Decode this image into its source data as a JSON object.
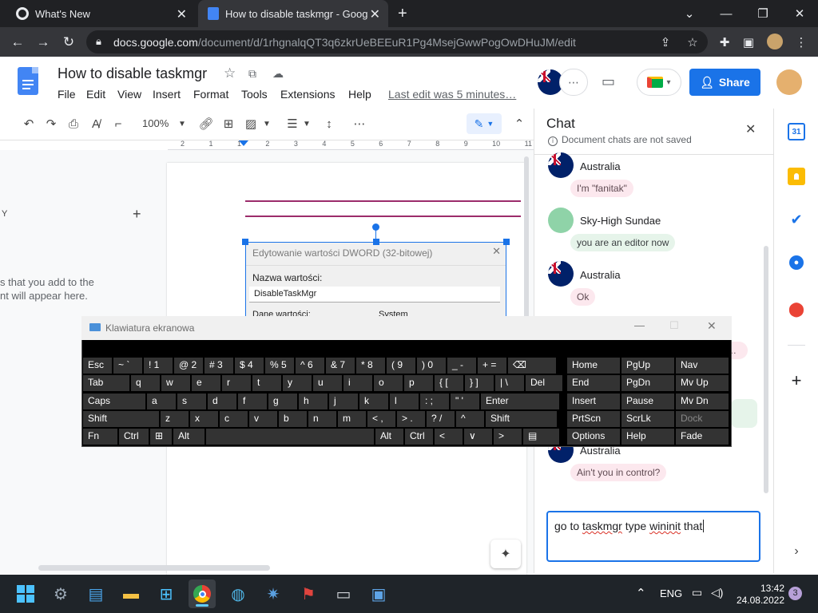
{
  "browser": {
    "tabs": [
      {
        "title": "What's New"
      },
      {
        "title": "How to disable taskmgr - Google Docs"
      }
    ],
    "url_host": "docs.google.com",
    "url_path": "/document/d/1rhgnalqQT3q6zkrUeBEEuR1Pg4MsejGwwPogOwDHuJM/edit"
  },
  "docs": {
    "title": "How to disable taskmgr",
    "menu": [
      "File",
      "Edit",
      "View",
      "Insert",
      "Format",
      "Tools",
      "Extensions",
      "Help"
    ],
    "last_edit": "Last edit was 5 minutes…",
    "share_label": "Share",
    "zoom": "100%",
    "outline_hint_1": "s that you add to the",
    "outline_hint_2": "nt will appear here.",
    "outline_letter": "Y",
    "ruler_marks": [
      "2",
      "1",
      "1",
      "2",
      "3",
      "4",
      "5",
      "6",
      "7",
      "8",
      "9",
      "10",
      "11"
    ]
  },
  "embedded_dialog": {
    "title": "Edytowanie wartości DWORD (32-bitowej)",
    "name_label": "Nazwa wartości:",
    "name_value": "DisableTaskMgr",
    "data_label": "Dane wartości:",
    "base_label": "System"
  },
  "chat": {
    "title": "Chat",
    "subtitle": "Document chats are not saved",
    "messages": [
      {
        "sender": "Australia",
        "text": "I'm \"fanitak\""
      },
      {
        "sender": "Sky-High Sundae",
        "text": "you are an editor now"
      },
      {
        "sender": "Australia",
        "text": "Ok"
      },
      {
        "sender": "Australia",
        "text": "Ain't you in control?"
      }
    ],
    "partial_text": "y…",
    "input_parts": [
      "go to ",
      "taskmgr",
      " type ",
      "wininit",
      " that "
    ]
  },
  "osk": {
    "title": "Klawiatura ekranowa",
    "rows": [
      [
        {
          "k": "Esc"
        },
        {
          "k": "~ `"
        },
        {
          "k": "! 1"
        },
        {
          "k": "@ 2"
        },
        {
          "k": "# 3"
        },
        {
          "k": "$ 4"
        },
        {
          "k": "% 5"
        },
        {
          "k": "^ 6"
        },
        {
          "k": "& 7"
        },
        {
          "k": "* 8"
        },
        {
          "k": "( 9"
        },
        {
          "k": ") 0"
        },
        {
          "k": "_ -"
        },
        {
          "k": "+ ="
        },
        {
          "k": "⌫"
        }
      ],
      [
        {
          "k": "Tab"
        },
        {
          "k": "q"
        },
        {
          "k": "w"
        },
        {
          "k": "e"
        },
        {
          "k": "r"
        },
        {
          "k": "t"
        },
        {
          "k": "y"
        },
        {
          "k": "u"
        },
        {
          "k": "i"
        },
        {
          "k": "o"
        },
        {
          "k": "p"
        },
        {
          "k": "{ ["
        },
        {
          "k": "} ]"
        },
        {
          "k": "| \\"
        },
        {
          "k": "Del"
        }
      ],
      [
        {
          "k": "Caps"
        },
        {
          "k": "a"
        },
        {
          "k": "s"
        },
        {
          "k": "d"
        },
        {
          "k": "f"
        },
        {
          "k": "g"
        },
        {
          "k": "h"
        },
        {
          "k": "j"
        },
        {
          "k": "k"
        },
        {
          "k": "l"
        },
        {
          "k": ": ;"
        },
        {
          "k": "\" '"
        },
        {
          "k": "Enter"
        }
      ],
      [
        {
          "k": "Shift"
        },
        {
          "k": "z"
        },
        {
          "k": "x"
        },
        {
          "k": "c"
        },
        {
          "k": "v"
        },
        {
          "k": "b"
        },
        {
          "k": "n"
        },
        {
          "k": "m"
        },
        {
          "k": "< ,"
        },
        {
          "k": "> ."
        },
        {
          "k": "? /"
        },
        {
          "k": "^"
        },
        {
          "k": "Shift"
        }
      ],
      [
        {
          "k": "Fn"
        },
        {
          "k": "Ctrl"
        },
        {
          "k": "⊞"
        },
        {
          "k": "Alt"
        },
        {
          "k": ""
        },
        {
          "k": "Alt"
        },
        {
          "k": "Ctrl"
        },
        {
          "k": "<"
        },
        {
          "k": "∨"
        },
        {
          "k": ">"
        },
        {
          "k": "▤"
        }
      ]
    ],
    "nav_keys": [
      [
        "Home",
        "PgUp",
        "Nav"
      ],
      [
        "End",
        "PgDn",
        "Mv Up"
      ],
      [
        "Insert",
        "Pause",
        "Mv Dn"
      ],
      [
        "PrtScn",
        "ScrLk",
        "Dock"
      ],
      [
        "Options",
        "Help",
        "Fade"
      ]
    ]
  },
  "taskbar": {
    "lang": "ENG",
    "time": "13:42",
    "date": "24.08.2022",
    "notifications": "3"
  },
  "colors": {
    "share_blue": "#1a73e8",
    "docs_blue": "#4285f4",
    "chrome_dark": "#202124",
    "taskbar": "#1f2429"
  }
}
